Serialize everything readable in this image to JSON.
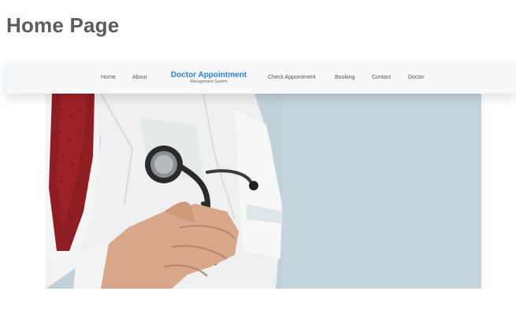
{
  "page": {
    "title": "Home Page"
  },
  "navbar": {
    "items_left": [
      {
        "label": "Home"
      },
      {
        "label": "About"
      }
    ],
    "brand": {
      "name": "Doctor Appointment",
      "subtitle": "Management System"
    },
    "items_right": [
      {
        "label": "Check Appointment"
      },
      {
        "label": "Booking"
      },
      {
        "label": "Contact"
      },
      {
        "label": "Doctor"
      }
    ]
  },
  "hero": {
    "image": "doctor-with-stethoscope",
    "background_color": "#c2d1d9"
  },
  "colors": {
    "brand_blue": "#2f7fd8",
    "title_gray": "#5b5b5b",
    "nav_text": "#555555",
    "navbar_bg": "#f7f8fa"
  }
}
